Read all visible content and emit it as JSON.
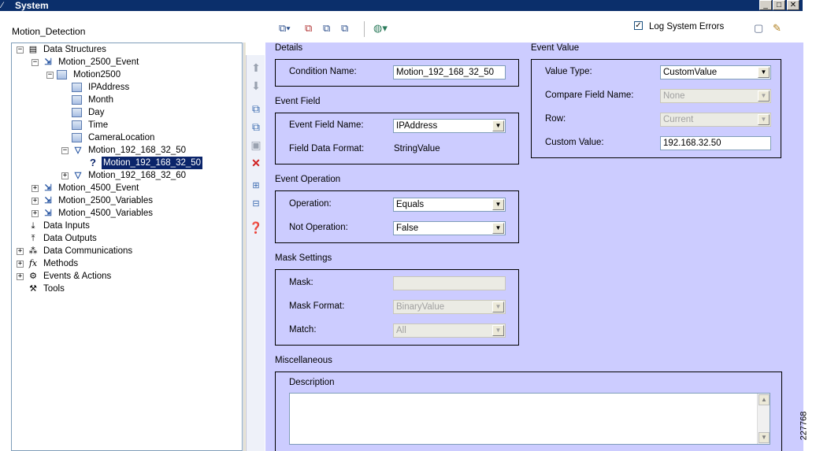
{
  "window": {
    "title": "System"
  },
  "left": {
    "label": "Motion_Detection",
    "tree": [
      {
        "label": "Data Structures",
        "icon": "structures-icon",
        "expander": "−"
      },
      {
        "label": "Motion_2500_Event",
        "icon": "event-icon",
        "expander": "−"
      },
      {
        "label": "Motion2500",
        "icon": "table-icon",
        "expander": "−"
      },
      {
        "label": "IPAddress",
        "icon": "field-icon",
        "expander": ""
      },
      {
        "label": "Month",
        "icon": "field-icon",
        "expander": ""
      },
      {
        "label": "Day",
        "icon": "field-icon",
        "expander": ""
      },
      {
        "label": "Time",
        "icon": "field-icon",
        "expander": ""
      },
      {
        "label": "CameraLocation",
        "icon": "field-icon",
        "expander": ""
      },
      {
        "label": "Motion_192_168_32_50",
        "icon": "condition-icon",
        "expander": "−"
      },
      {
        "label": "Motion_192_168_32_50",
        "icon": "question-icon",
        "expander": ""
      },
      {
        "label": "Motion_192_168_32_60",
        "icon": "condition-icon",
        "expander": "+"
      },
      {
        "label": "Motion_4500_Event",
        "icon": "event-icon",
        "expander": "+"
      },
      {
        "label": "Motion_2500_Variables",
        "icon": "event-icon",
        "expander": "+"
      },
      {
        "label": "Motion_4500_Variables",
        "icon": "event-icon",
        "expander": "+"
      },
      {
        "label": "Data Inputs",
        "icon": "data-inputs-icon",
        "expander": ""
      },
      {
        "label": "Data Outputs",
        "icon": "data-outputs-icon",
        "expander": ""
      },
      {
        "label": "Data Communications",
        "icon": "communications-icon",
        "expander": "+"
      },
      {
        "label": "Methods",
        "icon": "methods-icon",
        "expander": "+"
      },
      {
        "label": "Events & Actions",
        "icon": "events-actions-icon",
        "expander": "+"
      },
      {
        "label": "Tools",
        "icon": "tools-icon",
        "expander": ""
      }
    ]
  },
  "toolbar": {
    "log_errors_label": "Log System Errors",
    "log_errors_checked": "✓"
  },
  "details": {
    "title": "Details",
    "condition_name_label": "Condition Name:",
    "condition_name_value": "Motion_192_168_32_50"
  },
  "event_field": {
    "title": "Event Field",
    "name_label": "Event Field Name:",
    "name_value": "IPAddress",
    "format_label": "Field Data Format:",
    "format_value": "StringValue"
  },
  "event_operation": {
    "title": "Event Operation",
    "operation_label": "Operation:",
    "operation_value": "Equals",
    "not_label": "Not Operation:",
    "not_value": "False"
  },
  "mask": {
    "title": "Mask Settings",
    "mask_label": "Mask:",
    "mask_value": "",
    "format_label": "Mask Format:",
    "format_value": "BinaryValue",
    "match_label": "Match:",
    "match_value": "All"
  },
  "misc": {
    "title": "Miscellaneous",
    "description_label": "Description",
    "description_value": ""
  },
  "event_value": {
    "title": "Event Value",
    "value_type_label": "Value Type:",
    "value_type_value": "CustomValue",
    "compare_label": "Compare Field Name:",
    "compare_value": "None",
    "row_label": "Row:",
    "row_value": "Current",
    "custom_label": "Custom Value:",
    "custom_value": "192.168.32.50"
  },
  "watermark": "227768",
  "colors": {
    "panel": "#ccccff",
    "titlebar": "#0b2f6b",
    "selection": "#0a246a"
  }
}
